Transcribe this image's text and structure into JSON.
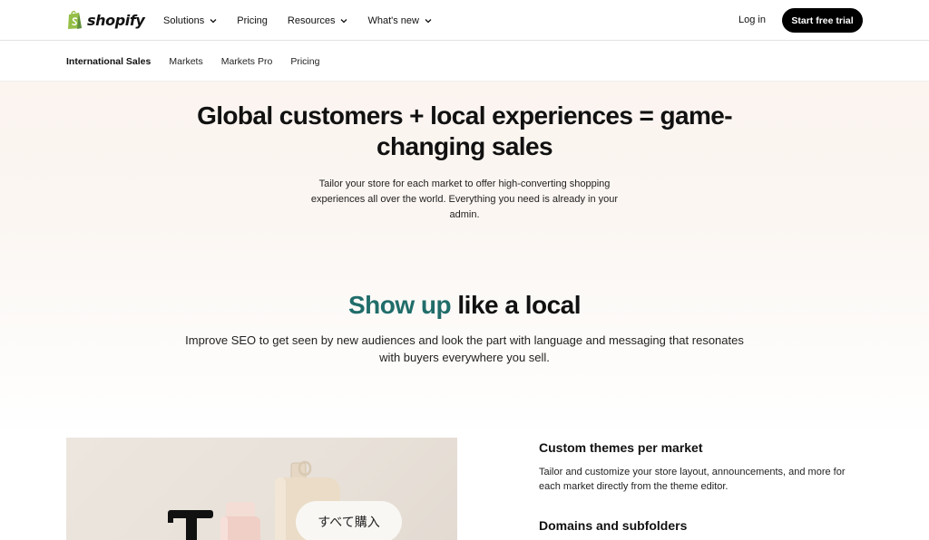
{
  "brand": {
    "name": "shopify",
    "color": "#95bf47"
  },
  "nav": {
    "items": [
      {
        "label": "Solutions",
        "dropdown": true
      },
      {
        "label": "Pricing",
        "dropdown": false
      },
      {
        "label": "Resources",
        "dropdown": true
      },
      {
        "label": "What's new",
        "dropdown": true
      }
    ],
    "login": "Log in",
    "cta": "Start free trial"
  },
  "subnav": {
    "items": [
      {
        "label": "International Sales",
        "active": true
      },
      {
        "label": "Markets",
        "active": false
      },
      {
        "label": "Markets Pro",
        "active": false
      },
      {
        "label": "Pricing",
        "active": false
      }
    ]
  },
  "hero": {
    "title": "Global customers + local experiences = game-changing sales",
    "subtitle": "Tailor your store for each market to offer high-converting shopping experiences all over the world. Everything you need is already in your admin."
  },
  "section": {
    "title_highlight": "Show up",
    "title_rest": " like a local",
    "subtitle": "Improve SEO to get seen by new audiences and look the part with language and messaging that resonates with buyers everywhere you sell.",
    "accent_color": "#206d6a"
  },
  "product_image": {
    "button_label": "すべて購入"
  },
  "features": [
    {
      "title": "Custom themes per market",
      "description": "Tailor and customize your store layout, announcements, and more for each market directly from the theme editor."
    },
    {
      "title": "Domains and subfolders",
      "description": ""
    }
  ]
}
